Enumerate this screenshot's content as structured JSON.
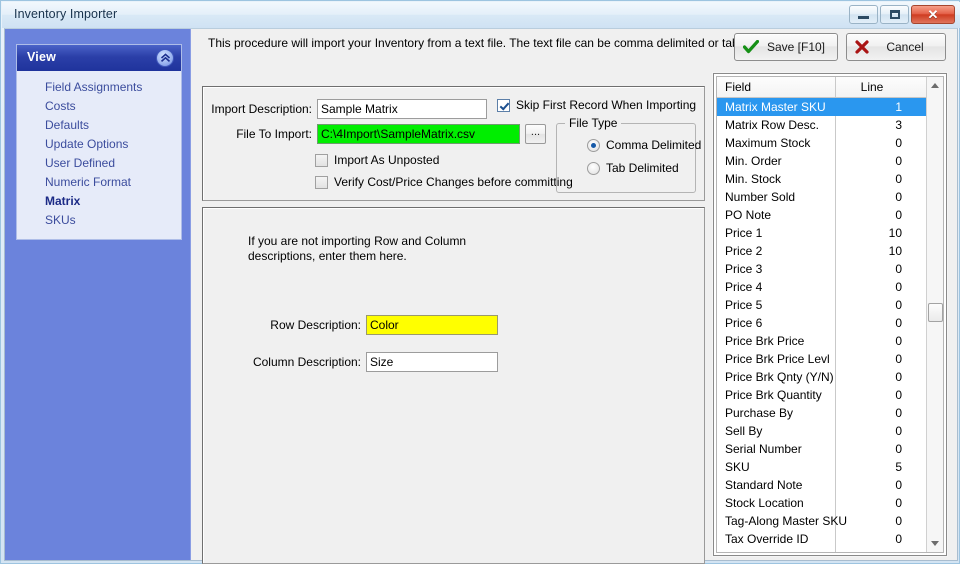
{
  "window": {
    "title": "Inventory Importer",
    "buttons": {
      "minimize": "minimize-button",
      "maximize": "maximize-button",
      "close": "✕"
    }
  },
  "sidebar": {
    "panel_title": "View",
    "collapse_icon": "chevron-up-circle-icon",
    "items": [
      {
        "label": "Field Assignments",
        "active": false
      },
      {
        "label": "Costs",
        "active": false
      },
      {
        "label": "Defaults",
        "active": false
      },
      {
        "label": "Update Options",
        "active": false
      },
      {
        "label": "User Defined",
        "active": false
      },
      {
        "label": "Numeric Format",
        "active": false
      },
      {
        "label": "Matrix",
        "active": true
      },
      {
        "label": "SKUs",
        "active": false
      }
    ]
  },
  "header": {
    "instruction": "This procedure will import your Inventory from a text file.  The text file can be comma delimited or tab delimited.",
    "save_label": "Save [F10]",
    "save_icon": "checkmark-icon",
    "cancel_label": "Cancel",
    "cancel_icon": "x-mark-icon"
  },
  "form": {
    "import_description_label": "Import Description:",
    "import_description_value": "Sample Matrix",
    "file_to_import_label": "File To Import:",
    "file_to_import_value": "C:\\4Import\\SampleMatrix.csv",
    "browse_label": "...",
    "skip_first_record_label": "Skip First Record When Importing",
    "skip_first_record_checked": true,
    "import_as_unposted_label": "Import As Unposted",
    "import_as_unposted_checked": false,
    "verify_cost_label": "Verify Cost/Price Changes before committing",
    "verify_cost_checked": false,
    "file_type_group_label": "File Type",
    "file_type_options": [
      {
        "label": "Comma Delimited",
        "selected": true
      },
      {
        "label": "Tab Delimited",
        "selected": false
      }
    ]
  },
  "matrix": {
    "hint_line1": "If you are not importing Row and Column",
    "hint_line2": "descriptions, enter them here.",
    "row_description_label": "Row Description:",
    "row_description_value": "Color",
    "column_description_label": "Column Description:",
    "column_description_value": "Size"
  },
  "grid": {
    "columns": [
      "Field",
      "Line"
    ],
    "selected_index": 0,
    "rows": [
      {
        "field": "Matrix Master SKU",
        "line": "1"
      },
      {
        "field": "Matrix Row Desc.",
        "line": "3"
      },
      {
        "field": "Maximum Stock",
        "line": "0"
      },
      {
        "field": "Min. Order",
        "line": "0"
      },
      {
        "field": "Min. Stock",
        "line": "0"
      },
      {
        "field": "Number Sold",
        "line": "0"
      },
      {
        "field": "PO Note",
        "line": "0"
      },
      {
        "field": "Price 1",
        "line": "10"
      },
      {
        "field": "Price 2",
        "line": "10"
      },
      {
        "field": "Price 3",
        "line": "0"
      },
      {
        "field": "Price 4",
        "line": "0"
      },
      {
        "field": "Price 5",
        "line": "0"
      },
      {
        "field": "Price 6",
        "line": "0"
      },
      {
        "field": "Price Brk Price",
        "line": "0"
      },
      {
        "field": "Price Brk Price Levl",
        "line": "0"
      },
      {
        "field": "Price Brk Qnty (Y/N)",
        "line": "0"
      },
      {
        "field": "Price Brk Quantity",
        "line": "0"
      },
      {
        "field": "Purchase By",
        "line": "0"
      },
      {
        "field": "Sell By",
        "line": "0"
      },
      {
        "field": "Serial Number",
        "line": "0"
      },
      {
        "field": "SKU",
        "line": "5"
      },
      {
        "field": "Standard Note",
        "line": "0"
      },
      {
        "field": "Stock Location",
        "line": "0"
      },
      {
        "field": "Tag-Along Master SKU",
        "line": "0"
      },
      {
        "field": "Tax Override ID",
        "line": "0"
      }
    ],
    "scroll_up_icon": "arrow-up-icon",
    "scroll_down_icon": "arrow-down-icon"
  },
  "colors": {
    "sidebar_blue": "#6b83dc",
    "nav_header_blue": "#2b3fa8",
    "selection_blue": "#2a97ef",
    "file_path_highlight": "#00ee00",
    "row_desc_highlight": "#ffff00"
  }
}
